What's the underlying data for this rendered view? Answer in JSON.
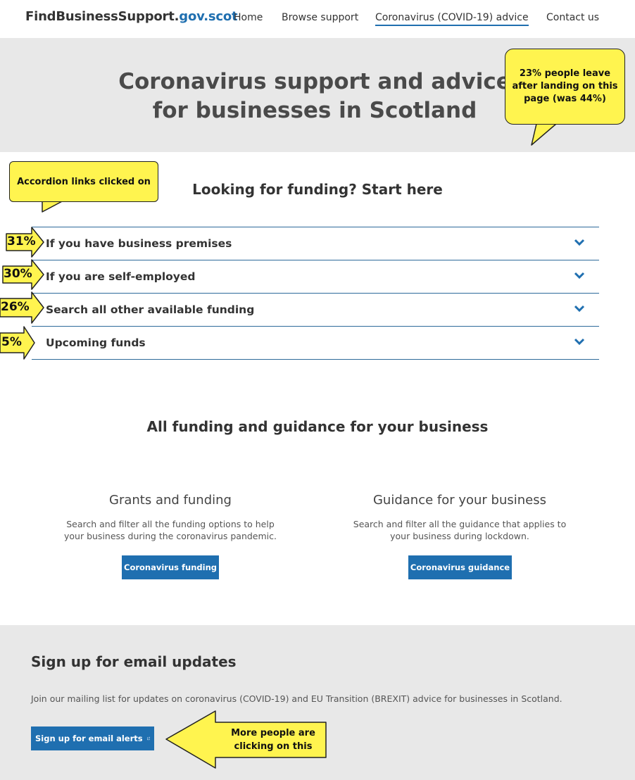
{
  "nav": {
    "brand_main": "FindBusinessSupport.",
    "brand_accent": "gov.scot",
    "links": [
      "Home",
      "Browse support",
      "Coronavirus (COVID-19) advice",
      "Contact us"
    ]
  },
  "hero": {
    "title_line1": "Coronavirus support and advice",
    "title_line2": "for businesses in Scotland"
  },
  "funding": {
    "heading": "Looking for funding? Start here",
    "items": [
      {
        "label": "If you have business premises",
        "pct": "31%"
      },
      {
        "label": "If you are self-employed",
        "pct": "30%"
      },
      {
        "label": "Search all other available funding",
        "pct": "26%"
      },
      {
        "label": "Upcoming funds",
        "pct": "5%"
      }
    ]
  },
  "all_funding": {
    "heading": "All funding and guidance for your business",
    "cards": [
      {
        "title": "Grants and funding",
        "text": "Search and filter all the funding options to help your business during the coronavirus pandemic.",
        "button": "Coronavirus funding"
      },
      {
        "title": "Guidance for your business",
        "text": "Search and filter all the guidance that applies to your business during lockdown.",
        "button": "Coronavirus guidance"
      }
    ]
  },
  "signup": {
    "heading": "Sign up for email updates",
    "text": "Join our mailing list for updates on coronavirus (COVID-19) and EU Transition (BREXIT) advice for businesses in Scotland.",
    "button": "Sign up for email alerts"
  },
  "annotations": {
    "hero_note": "23% people leave after landing on this page (was 44%)",
    "accordion_note": "Accordion links clicked on",
    "signup_note": "More people are clicking on this"
  },
  "colors": {
    "accent": "#1f6fb0",
    "note_fill": "#fff44f",
    "hero_bg": "#e8e8e8"
  }
}
